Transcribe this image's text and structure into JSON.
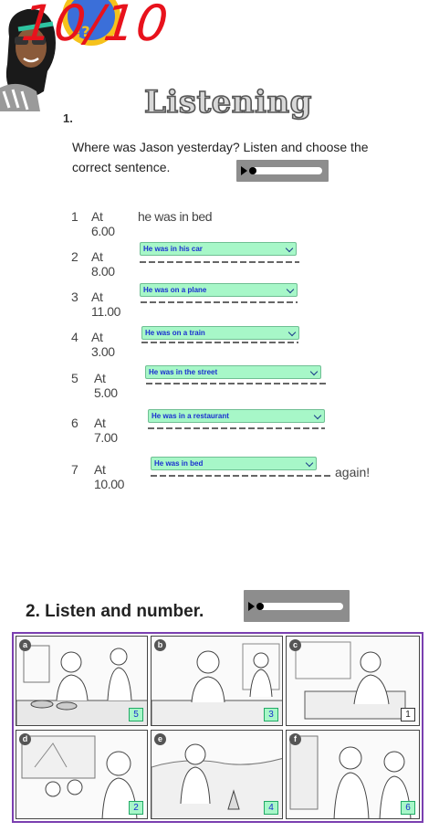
{
  "score": "10/10",
  "exercise1": {
    "number": "1.",
    "title": "Listening",
    "instruction": "Where was Jason yesterday? Listen and choose the correct sentence.",
    "items": [
      {
        "num": "1",
        "time": "At 6.00",
        "text": "he was in bed"
      },
      {
        "num": "2",
        "time": "At 8.00",
        "answer": "He was in his car"
      },
      {
        "num": "3",
        "time": "At 11.00",
        "answer": "He was on a plane"
      },
      {
        "num": "4",
        "time": "At 3.00",
        "answer": "He was on a train"
      },
      {
        "num": "5",
        "time": "At 5.00",
        "answer": "He was in the street"
      },
      {
        "num": "6",
        "time": "At 7.00",
        "answer": "He was in a restaurant"
      },
      {
        "num": "7",
        "time": "At 10.00",
        "answer": "He was in bed",
        "suffix": "again!"
      }
    ]
  },
  "exercise2": {
    "title": "2. Listen and number.",
    "panels": [
      {
        "letter": "a",
        "answer": "5"
      },
      {
        "letter": "b",
        "answer": "3"
      },
      {
        "letter": "c",
        "answer": "1"
      },
      {
        "letter": "d",
        "answer": "2"
      },
      {
        "letter": "e",
        "answer": "4"
      },
      {
        "letter": "f",
        "answer": "6"
      }
    ]
  },
  "icons": {
    "audio_play": "play-icon",
    "dropdown": "chevron-down-icon"
  },
  "colors": {
    "score": "#e8121c",
    "dropdown_bg": "#a7f7c8",
    "dropdown_text": "#1a30d0",
    "frame": "#7a3fb0"
  }
}
